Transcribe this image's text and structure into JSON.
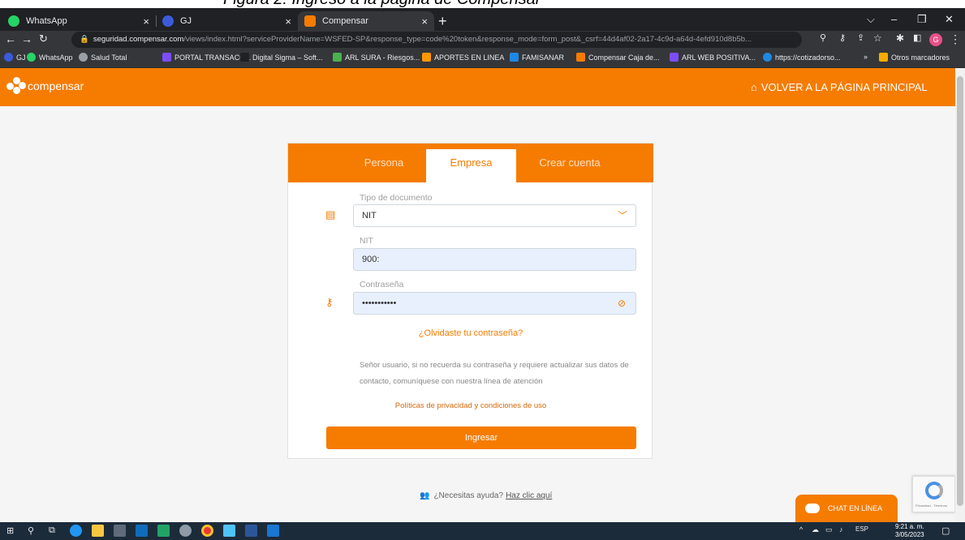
{
  "caption": "Figura 2: Ingreso a la página de Compensar",
  "browser": {
    "tabs": [
      {
        "title": "WhatsApp"
      },
      {
        "title": "GJ"
      },
      {
        "title": "Compensar"
      }
    ],
    "url_domain": "seguridad.compensar.com",
    "url_path": "/views/index.html?serviceProviderName=WSFED-SP&response_type=code%20token&response_mode=form_post&_csrf=44d4af02-2a17-4c9d-a64d-4efd910d8b5b...",
    "profile_letter": "G",
    "bookmarks": [
      "GJ",
      "WhatsApp",
      "Salud Total",
      "PORTAL TRANSACC...",
      "Digital Sigma – Soft...",
      "ARL SURA - Riesgos...",
      "APORTES EN LINEA",
      "FAMISANAR",
      "Compensar Caja de...",
      "ARL WEB POSITIVA...",
      "https://cotizadorso..."
    ],
    "bookmarks_more": "»",
    "other_bookmarks": "Otros marcadores"
  },
  "header": {
    "logo_text": "compensar",
    "home_link": "VOLVER A LA PÁGINA PRINCIPAL"
  },
  "login": {
    "tabs": [
      "Persona",
      "Empresa",
      "Crear cuenta"
    ],
    "active_tab": "Empresa",
    "doc_type_label": "Tipo de documento",
    "doc_type_value": "NIT",
    "nit_label": "NIT",
    "nit_value": "900:",
    "password_label": "Contraseña",
    "password_value": "•••••••••••",
    "forgot": "¿Olvidaste tu contraseña?",
    "info": "Señor usuario, si no recuerda su contraseña y requiere actualizar sus datos de contacto, comuníquese con nuestra línea de atención",
    "privacy": "Políticas de privacidad y condiciones de uso",
    "submit": "Ingresar"
  },
  "help": {
    "text": "¿Necesitas ayuda?",
    "link": "Haz clic aquí"
  },
  "chat": "CHAT EN LÍNEA",
  "recaptcha_text": "Privacidad - Términos",
  "taskbar": {
    "lang": "ESP",
    "time": "9:21 a. m.",
    "date": "3/05/2023"
  },
  "colors": {
    "brand": "#f57c00",
    "browser_dark": "#202124",
    "taskbar": "#1c2b3a"
  }
}
